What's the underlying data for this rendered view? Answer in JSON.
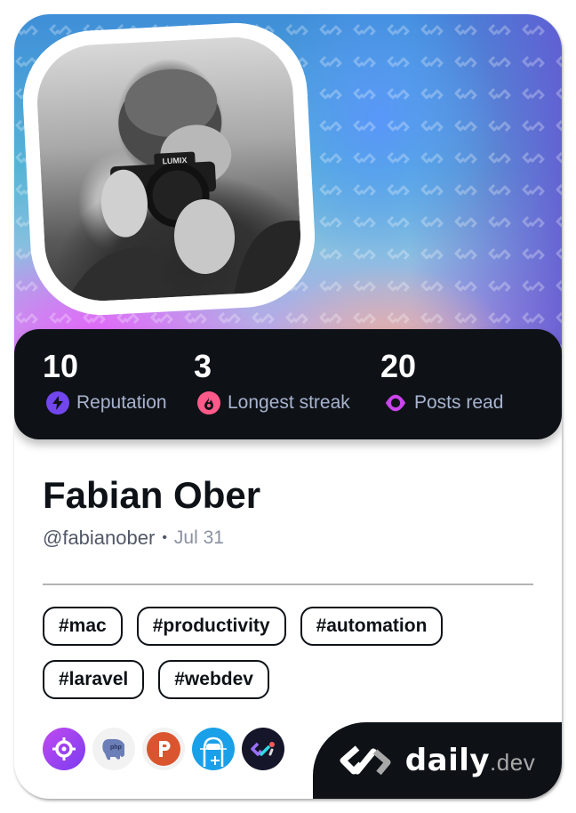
{
  "profile": {
    "name": "Fabian Ober",
    "handle": "@fabianober",
    "separator": "•",
    "date": "Jul 31"
  },
  "stats": [
    {
      "value": "10",
      "label": "Reputation",
      "icon": "lightning-icon",
      "color": "#7147ed"
    },
    {
      "value": "3",
      "label": "Longest streak",
      "icon": "flame-icon",
      "color": "#ff5a8a"
    },
    {
      "value": "20",
      "label": "Posts read",
      "icon": "eye-icon",
      "color": "#cc44ee"
    }
  ],
  "tags": [
    "#mac",
    "#productivity",
    "#automation",
    "#laravel",
    "#webdev"
  ],
  "sources": [
    {
      "name": "crosshair-source",
      "color": "#9a44f0"
    },
    {
      "name": "php-source",
      "color": "#eeeeee"
    },
    {
      "name": "product-hunt-source",
      "color": "#da552f"
    },
    {
      "name": "astronaut-source",
      "color": "#1aa0e8"
    },
    {
      "name": "daily-dev-source",
      "color": "#1a1a2e"
    }
  ],
  "brand": {
    "name": "daily",
    "tld": ".dev"
  },
  "colors": {
    "dark": "#0e1217",
    "label": "#a8b3cf",
    "divider": "#b3b3b3"
  }
}
